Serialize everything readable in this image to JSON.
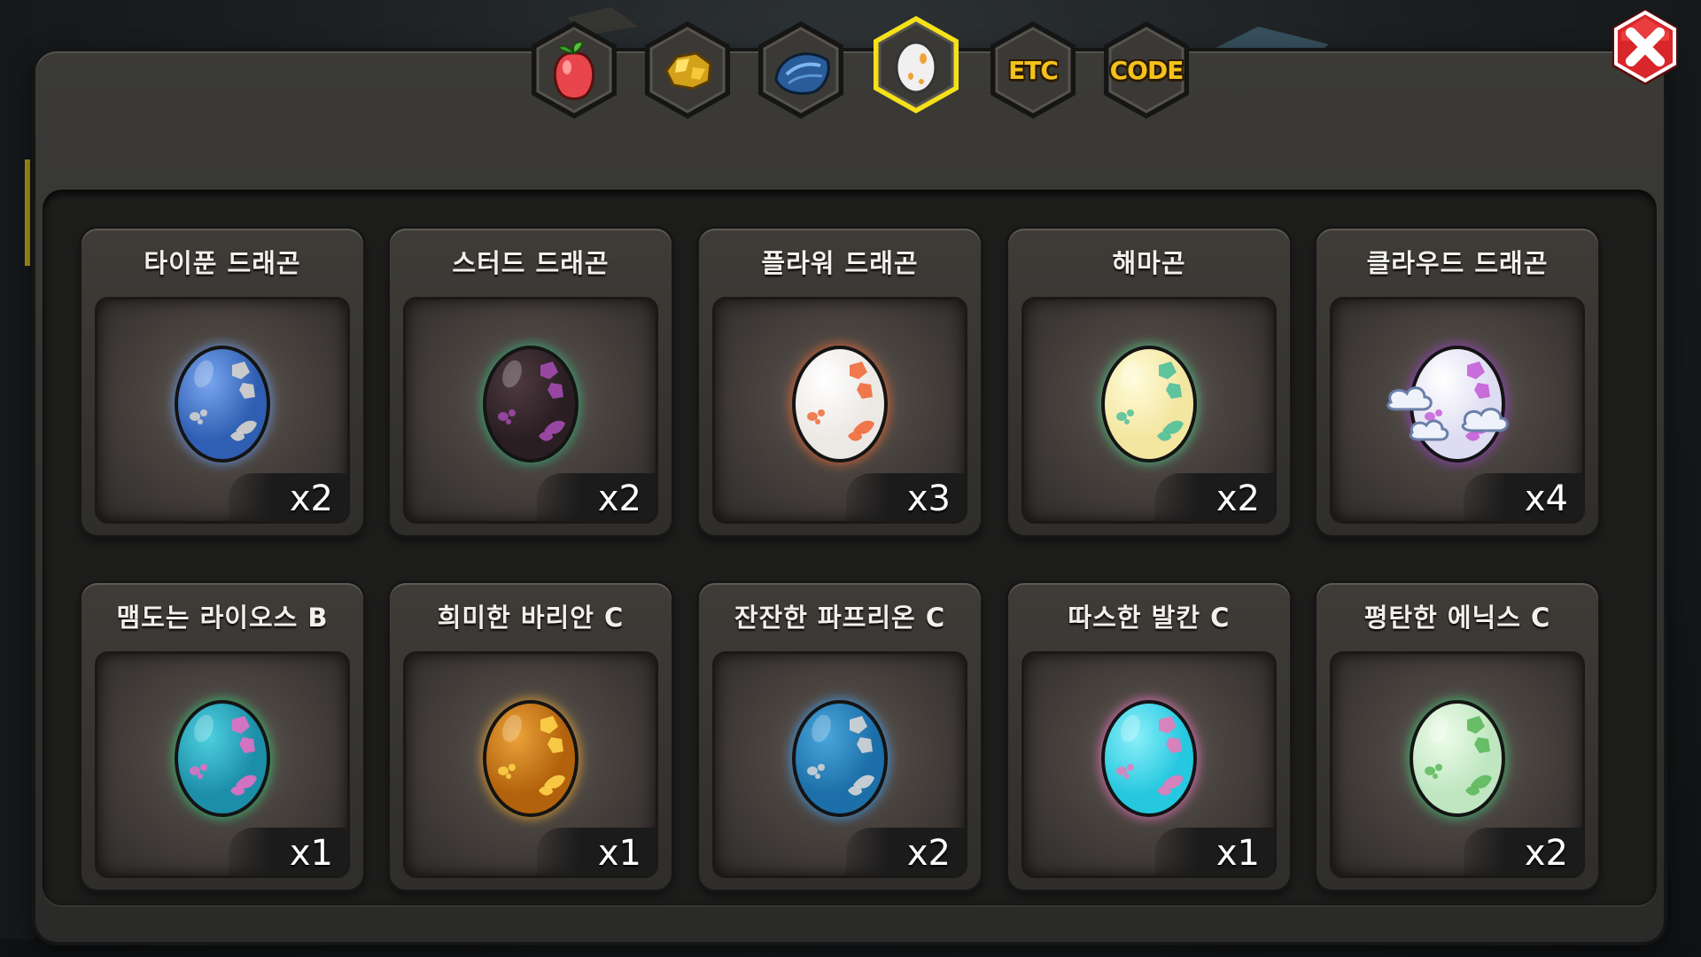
{
  "tabs": [
    {
      "id": "fruit",
      "label": "",
      "icon": "fruit-icon",
      "active": false
    },
    {
      "id": "gold",
      "label": "",
      "icon": "gold-nugget-icon",
      "active": false
    },
    {
      "id": "scale",
      "label": "",
      "icon": "dragon-scale-icon",
      "active": false
    },
    {
      "id": "egg",
      "label": "",
      "icon": "egg-icon",
      "active": true
    },
    {
      "id": "etc",
      "label": "ETC",
      "icon": "",
      "active": false
    },
    {
      "id": "code",
      "label": "CODE",
      "icon": "",
      "active": false
    }
  ],
  "colors": {
    "tab_active_border": "#f5e11a",
    "text_gold": "#f4c21c",
    "close_red": "#d9262a"
  },
  "close_icon": "close-icon",
  "items": [
    {
      "name": "타이푼 드래곤",
      "count": "x2",
      "egg": {
        "base": "#2f5fb3",
        "light": "#7aa6ee",
        "spot": "#d8d4cc",
        "glow": "#6aa2ff"
      }
    },
    {
      "name": "스터드 드래곤",
      "count": "x2",
      "egg": {
        "base": "#2a1e22",
        "light": "#4d3a3f",
        "spot": "#a34bb0",
        "glow": "#29c07a"
      }
    },
    {
      "name": "플라워 드래곤",
      "count": "x3",
      "egg": {
        "base": "#ece8e4",
        "light": "#ffffff",
        "spot": "#f06a3a",
        "glow": "#ff6a2e"
      }
    },
    {
      "name": "해마곤",
      "count": "x2",
      "egg": {
        "base": "#f3e6a0",
        "light": "#fffbd8",
        "spot": "#4fbf9a",
        "glow": "#4fd08a"
      }
    },
    {
      "name": "클라우드 드래곤",
      "count": "x4",
      "egg": {
        "base": "#dedcf2",
        "light": "#ffffff",
        "spot": "#c45fd6",
        "glow": "#a23ad6"
      }
    },
    {
      "name": "맴도는 라이오스 B",
      "count": "x1",
      "egg": {
        "base": "#1d8ea8",
        "light": "#4ed0e0",
        "spot": "#e56fc4",
        "glow": "#2fd178"
      }
    },
    {
      "name": "희미한 바리안 C",
      "count": "x1",
      "egg": {
        "base": "#b2620c",
        "light": "#eba33a",
        "spot": "#ffd34a",
        "glow": "#ffb02e"
      }
    },
    {
      "name": "잔잔한 파프리온 C",
      "count": "x2",
      "egg": {
        "base": "#1c6fa8",
        "light": "#4aa6dc",
        "spot": "#d6d6d6",
        "glow": "#3fa8ff"
      }
    },
    {
      "name": "따스한 발칸 C",
      "count": "x1",
      "egg": {
        "base": "#26c8e0",
        "light": "#8cf0fa",
        "spot": "#e77ab8",
        "glow": "#ff7ad0"
      }
    },
    {
      "name": "평탄한 에닉스 C",
      "count": "x2",
      "egg": {
        "base": "#bfe6c0",
        "light": "#eefcea",
        "spot": "#5cb85c",
        "glow": "#3fd07a"
      }
    }
  ]
}
